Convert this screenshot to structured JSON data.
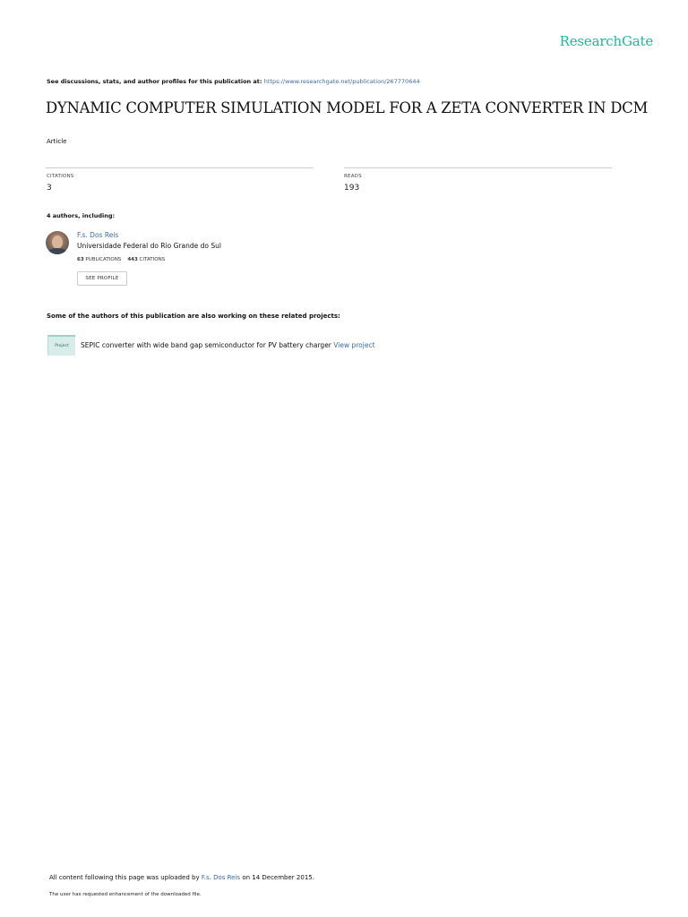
{
  "brand": {
    "logo_text": "ResearchGate",
    "accent_color": "#1bb89b",
    "link_color": "#3a6aa8"
  },
  "discussion": {
    "prefix": "See discussions, stats, and author profiles for this publication at:",
    "url": "https://www.researchgate.net/publication/267770644"
  },
  "publication": {
    "title": "DYNAMIC COMPUTER SIMULATION MODEL FOR A ZETA CONVERTER IN DCM",
    "type": "Article"
  },
  "stats": {
    "citations_label": "CITATIONS",
    "citations_value": "3",
    "reads_label": "READS",
    "reads_value": "193"
  },
  "authors": {
    "heading": "4 authors, including:",
    "items": [
      {
        "name": "F.s. Dos Reis",
        "affiliation": "Universidade Federal do Rio Grande do Sul",
        "publications_count": "63",
        "publications_label": "PUBLICATIONS",
        "citations_count": "443",
        "citations_label": "CITATIONS",
        "profile_button": "SEE PROFILE"
      }
    ]
  },
  "related": {
    "heading": "Some of the authors of this publication are also working on these related projects:",
    "projects": [
      {
        "icon_label": "Project",
        "title": "SEPIC converter with wide band gap semiconductor for PV battery charger",
        "link_label": "View project"
      }
    ]
  },
  "footer": {
    "uploaded_prefix": "All content following this page was uploaded by",
    "uploader": "F.s. Dos Reis",
    "uploaded_suffix": "on 14 December 2015.",
    "enhancement_note": "The user has requested enhancement of the downloaded file."
  }
}
